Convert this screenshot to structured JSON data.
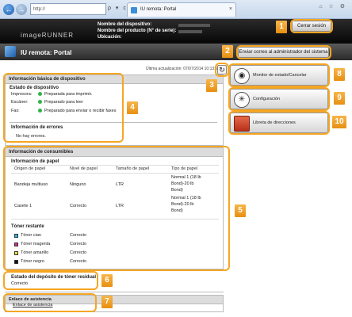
{
  "browser": {
    "address": "http://",
    "tab_title": "IU remota: Portal",
    "address_tools": "ρ ▾ c"
  },
  "header": {
    "logo": "imageRUNNER",
    "device_name_label": "Nombre del dispositivo:",
    "product_name_label": "Nombre del producto (N° de serie):",
    "location_label": "Ubicación:",
    "logout": "Cerrar sesión"
  },
  "titlebar": {
    "title": "IU remota: Portal",
    "mail_admin": "Enviar correo al administrador del sistema"
  },
  "update": {
    "text": "Última actualización: 07/07/2014 10:13:52 PM"
  },
  "device_info": {
    "heading": "Información básica de dispositivo",
    "status_heading": "Estado de dispositivo",
    "rows": [
      {
        "label": "Impresora:",
        "value": "Preparada para imprimir."
      },
      {
        "label": "Escáner:",
        "value": "Preparado para leer"
      },
      {
        "label": "Fax:",
        "value": "Preparado para enviar o recibir faxes"
      }
    ],
    "error_heading": "Información de errores",
    "error_value": "No hay errores."
  },
  "consumables": {
    "heading": "Información de consumibles",
    "paper_heading": "Información de papel",
    "columns": [
      "Origen de papel",
      "Nivel de papel",
      "Tamaño de papel",
      "Tipo de papel"
    ],
    "paper_rows": [
      {
        "source": "Bandeja multiuso",
        "level": "Ninguno",
        "size": "LTR",
        "type1": "Normal 1 (18 lb",
        "type2": "Bond)-20 lb",
        "type3": "Bond)"
      },
      {
        "source": "Casete 1",
        "level": "Correcto",
        "size": "LTR",
        "type1": "Normal 1 (18 lb",
        "type2": "Bond)-20 lb",
        "type3": "Bond)"
      }
    ],
    "toner_heading": "Tóner restante",
    "toners": [
      {
        "name": "Tóner cian",
        "status": "Correcto",
        "color": "#29b6e8"
      },
      {
        "name": "Tóner magenta",
        "status": "Correcto",
        "color": "#e0289a"
      },
      {
        "name": "Tóner amarillo",
        "status": "Correcto",
        "color": "#f5e12a"
      },
      {
        "name": "Tóner negro",
        "status": "Correcto",
        "color": "#111111"
      }
    ]
  },
  "waste_toner": {
    "heading": "Estado del depósito de tóner residual",
    "value": "Correcto"
  },
  "support": {
    "heading": "Enlace de asistencia",
    "value": "Enlace de asistencia"
  },
  "buttons": {
    "monitor": "Monitor de estado/Cancelar",
    "settings": "Configuración",
    "address_book": "Libreta de direcciones"
  },
  "callouts": [
    "1",
    "2",
    "3",
    "4",
    "5",
    "6",
    "7",
    "8",
    "9",
    "10"
  ],
  "accent_color": "#f5a623"
}
